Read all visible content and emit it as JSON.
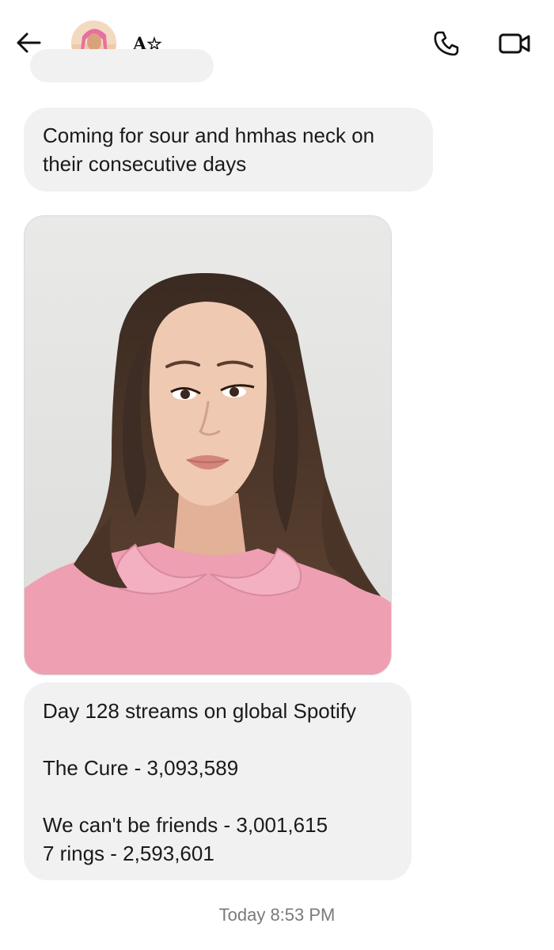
{
  "header": {
    "contact_name": "A☆",
    "icons": {
      "back": "arrow-left-icon",
      "call": "phone-icon",
      "video": "video-camera-icon"
    }
  },
  "messages": [
    {
      "type": "text",
      "text": "Coming for sour and hmhas neck on their consecutive days"
    },
    {
      "type": "image",
      "subject": "portrait photo, woman in pink collared top"
    },
    {
      "type": "text",
      "lines": [
        "Day 128 streams on global Spotify",
        "",
        "The Cure - 3,093,589",
        "",
        "We can't be friends - 3,001,615",
        "7 rings - 2,593,601"
      ]
    }
  ],
  "timestamp": "Today 8:53 PM",
  "colors": {
    "bubble_bg": "#f1f1f1",
    "text": "#1a1a1a",
    "timestamp": "#7a7a7a"
  }
}
